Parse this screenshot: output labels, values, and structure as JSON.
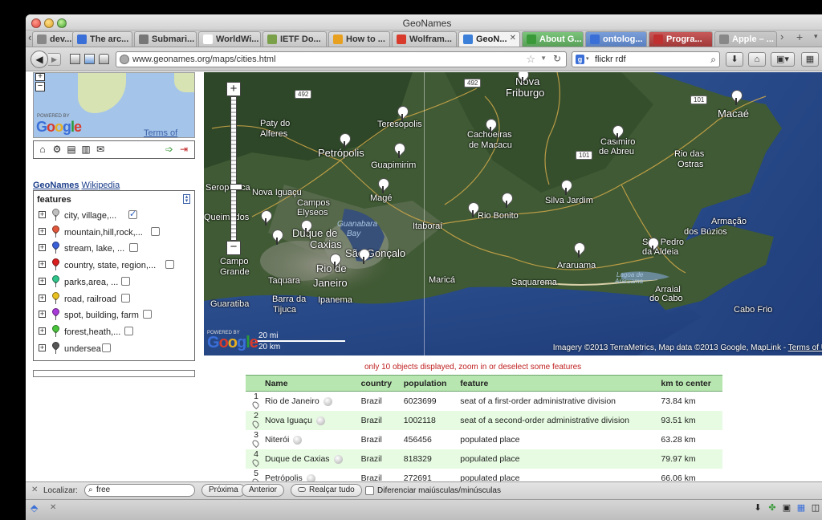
{
  "window": {
    "title": "GeoNames"
  },
  "tabs": [
    {
      "label": "dev...",
      "style": "normal"
    },
    {
      "label": "The arc...",
      "style": "normal"
    },
    {
      "label": "Submari...",
      "style": "normal"
    },
    {
      "label": "WorldWi...",
      "style": "normal"
    },
    {
      "label": "IETF Do...",
      "style": "normal"
    },
    {
      "label": "How to ...",
      "style": "normal"
    },
    {
      "label": "Wolfram...",
      "style": "normal"
    },
    {
      "label": "GeoN...",
      "style": "active",
      "close": "✕"
    },
    {
      "label": "About G...",
      "style": "green"
    },
    {
      "label": "ontolog...",
      "style": "blue"
    },
    {
      "label": "Progra...",
      "style": "red"
    },
    {
      "label": "Apple – ...",
      "style": "gray"
    }
  ],
  "navbar": {
    "url": "www.geonames.org/maps/cities.html",
    "search_engine": "g",
    "search_value": "flickr rdf"
  },
  "sidebar": {
    "minimap": {
      "powered": "POWERED BY",
      "logo": "Google",
      "terms": "Terms of Use"
    },
    "links": {
      "geonames": "GeoNames",
      "wikipedia": "Wikipedia"
    },
    "features_title": "features",
    "features": [
      {
        "label": "city, village,...",
        "color": "#bfbfbf",
        "checked": true
      },
      {
        "label": "mountain,hill,rock,...",
        "color": "#e0563a",
        "checked": false
      },
      {
        "label": "stream, lake, ...",
        "color": "#3a60d8",
        "checked": false
      },
      {
        "label": "country, state, region,...",
        "color": "#d81e1e",
        "checked": false
      },
      {
        "label": "parks,area, ...",
        "color": "#2ec48a",
        "checked": false
      },
      {
        "label": "road, railroad",
        "color": "#e8c020",
        "checked": false
      },
      {
        "label": "spot, building, farm",
        "color": "#a83ad8",
        "checked": false
      },
      {
        "label": "forest,heath,...",
        "color": "#48c43a",
        "checked": false
      },
      {
        "label": "undersea",
        "color": "#555555",
        "checked": false
      }
    ]
  },
  "map": {
    "labels": [
      {
        "text": "Nova",
        "big": true
      },
      {
        "text": "Friburgo",
        "big": true
      },
      {
        "text": "Macaé",
        "big": true
      },
      {
        "text": "Paty do",
        "big": false
      },
      {
        "text": "Alferes",
        "big": false
      },
      {
        "text": "Teresópolis",
        "big": false
      },
      {
        "text": "Cachoeiras",
        "big": false
      },
      {
        "text": "de Macacu",
        "big": false
      },
      {
        "text": "Casimiro",
        "big": false
      },
      {
        "text": "de Abreu",
        "big": false
      },
      {
        "text": "Rio das",
        "big": false
      },
      {
        "text": "Ostras",
        "big": false
      },
      {
        "text": "Petrópolis",
        "big": true
      },
      {
        "text": "Guapimirim",
        "big": false
      },
      {
        "text": "Magé",
        "big": false
      },
      {
        "text": "Silva Jardim",
        "big": false
      },
      {
        "text": "Campos",
        "big": false
      },
      {
        "text": "Elyseos",
        "big": false
      },
      {
        "text": "Queimados",
        "big": false
      },
      {
        "text": "Duque de",
        "big": true
      },
      {
        "text": "Caxias",
        "big": true
      },
      {
        "text": "Itaboraí",
        "big": false
      },
      {
        "text": "Rio Bonito",
        "big": false
      },
      {
        "text": "Armação",
        "big": false
      },
      {
        "text": "dos Búzios",
        "big": false
      },
      {
        "text": "São Gonçalo",
        "big": true
      },
      {
        "text": "São Pedro",
        "big": false
      },
      {
        "text": "da Aldeia",
        "big": false
      },
      {
        "text": "Campo",
        "big": false
      },
      {
        "text": "Grande",
        "big": false
      },
      {
        "text": "Rio de",
        "big": true
      },
      {
        "text": "Janeiro",
        "big": true
      },
      {
        "text": "Taquara",
        "big": false
      },
      {
        "text": "Maricá",
        "big": false
      },
      {
        "text": "Saquarema",
        "big": false
      },
      {
        "text": "Araruama",
        "big": false
      },
      {
        "text": "Arraial",
        "big": false
      },
      {
        "text": "do Cabo",
        "big": false
      },
      {
        "text": "Guaratiba",
        "big": false
      },
      {
        "text": "Barra da",
        "big": false
      },
      {
        "text": "Tijuca",
        "big": false
      },
      {
        "text": "Ipanema",
        "big": false
      },
      {
        "text": "Seropédica",
        "big": false
      },
      {
        "text": "Nova Iguaçu",
        "big": false
      },
      {
        "text": "Cabo Frio",
        "big": false
      }
    ],
    "water_labels": [
      "Guanabara",
      "Bay",
      "Lagoa de",
      "Araruama"
    ],
    "roads": [
      "492",
      "492",
      "101",
      "101"
    ],
    "scale_mi": "20 mi",
    "scale_km": "20 km",
    "logo": "Google",
    "powered": "POWERED BY",
    "copyright": "Imagery ©2013 TerraMetrics, Map data ©2013 Google, MapLink - ",
    "terms": "Terms of U"
  },
  "notice": "only 10 objects displayed, zoom in or deselect some features",
  "results": {
    "headers": [
      "",
      "Name",
      "country",
      "population",
      "feature",
      "km to center"
    ],
    "rows": [
      {
        "num": "1",
        "name": "Rio de Janeiro",
        "country": "Brazil",
        "population": "6023699",
        "feature": "seat of a first-order administrative division",
        "km": "73.84 km"
      },
      {
        "num": "2",
        "name": "Nova Iguaçu",
        "country": "Brazil",
        "population": "1002118",
        "feature": "seat of a second-order administrative division",
        "km": "93.51 km"
      },
      {
        "num": "3",
        "name": "Niterói",
        "country": "Brazil",
        "population": "456456",
        "feature": "populated place",
        "km": "63.28 km"
      },
      {
        "num": "4",
        "name": "Duque de Caxias",
        "country": "Brazil",
        "population": "818329",
        "feature": "populated place",
        "km": "79.97 km"
      },
      {
        "num": "5",
        "name": "Petrópolis",
        "country": "Brazil",
        "population": "272691",
        "feature": "populated place",
        "km": "66.06 km"
      }
    ]
  },
  "findbar": {
    "label": "Localizar:",
    "value": "free",
    "next": "Próxima",
    "prev": "Anterior",
    "highlight": "Realçar tudo",
    "match_case": "Diferenciar maiúsculas/minúsculas"
  }
}
